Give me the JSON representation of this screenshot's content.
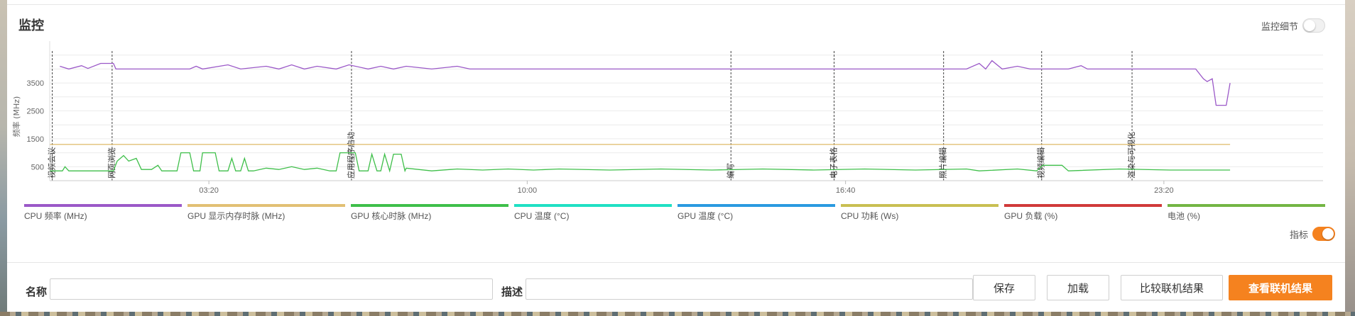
{
  "panel": {
    "title": "监控",
    "detail_toggle": {
      "label": "监控细节",
      "on": false
    },
    "indicator_toggle": {
      "label": "指标",
      "on": true
    }
  },
  "colors": {
    "accent": "#f5821f",
    "cpu_freq": "#9b59c8",
    "gpu_mem_clock": "#e2c074",
    "gpu_core_clock": "#3fbf4a",
    "cpu_temp": "#1fe0c4",
    "gpu_temp": "#2a9ae0",
    "cpu_power": "#c9bf52",
    "gpu_load": "#d03a3a",
    "battery": "#73b544"
  },
  "chart_data": {
    "type": "line",
    "ylabel": "频率 (MHz)",
    "ylim": [
      0,
      5000
    ],
    "y_ticks": [
      {
        "value": 500,
        "label": "500"
      },
      {
        "value": 1500,
        "label": "1500"
      },
      {
        "value": 2500,
        "label": "2500"
      },
      {
        "value": 3500,
        "label": "3500"
      }
    ],
    "x_range": [
      0,
      100
    ],
    "x_ticks": [
      {
        "x": 12.5,
        "label": "03:20"
      },
      {
        "x": 37.5,
        "label": "10:00"
      },
      {
        "x": 62.5,
        "label": "16:40"
      },
      {
        "x": 87.5,
        "label": "23:20"
      }
    ],
    "scenes": [
      {
        "x": 0.2,
        "label": "视频会议"
      },
      {
        "x": 4.9,
        "label": "网页浏览"
      },
      {
        "x": 23.7,
        "label": "应用程序启动"
      },
      {
        "x": 53.5,
        "label": "编写"
      },
      {
        "x": 61.6,
        "label": "电子表格"
      },
      {
        "x": 70.2,
        "label": "照片编辑"
      },
      {
        "x": 77.9,
        "label": "视频编辑"
      },
      {
        "x": 85.0,
        "label": "渲染与可视化"
      }
    ],
    "series": [
      {
        "name": "CPU 频率 (MHz)",
        "color": "#9b59c8",
        "points": [
          [
            0.8,
            4100
          ],
          [
            1.5,
            4000
          ],
          [
            2.5,
            4120
          ],
          [
            3,
            4020
          ],
          [
            4,
            4200
          ],
          [
            5,
            4200
          ],
          [
            5.2,
            4000
          ],
          [
            11,
            4000
          ],
          [
            11.5,
            4100
          ],
          [
            12,
            4000
          ],
          [
            14,
            4150
          ],
          [
            15,
            4000
          ],
          [
            17,
            4100
          ],
          [
            18,
            4000
          ],
          [
            19,
            4150
          ],
          [
            20,
            4000
          ],
          [
            21,
            4100
          ],
          [
            22.5,
            4000
          ],
          [
            23.5,
            4150
          ],
          [
            25,
            4000
          ],
          [
            26,
            4100
          ],
          [
            27,
            4000
          ],
          [
            28,
            4100
          ],
          [
            30,
            4000
          ],
          [
            32,
            4100
          ],
          [
            33,
            4000
          ],
          [
            48,
            4000
          ],
          [
            60,
            4000
          ],
          [
            72,
            4000
          ],
          [
            73,
            4200
          ],
          [
            73.5,
            4000
          ],
          [
            74,
            4300
          ],
          [
            74.8,
            4000
          ],
          [
            76,
            4100
          ],
          [
            77,
            4000
          ],
          [
            80,
            4000
          ],
          [
            81,
            4120
          ],
          [
            81.5,
            4000
          ],
          [
            86,
            4000
          ],
          [
            88,
            4000
          ],
          [
            90,
            4000
          ],
          [
            90.6,
            3650
          ],
          [
            90.9,
            3550
          ],
          [
            91.3,
            3650
          ],
          [
            91.6,
            2700
          ],
          [
            92.4,
            2700
          ],
          [
            92.7,
            3500
          ]
        ]
      },
      {
        "name": "GPU 显示内存时脉 (MHz)",
        "color": "#e2c074",
        "points": [
          [
            0,
            1300
          ],
          [
            92.7,
            1300
          ]
        ]
      },
      {
        "name": "GPU 核心时脉 (MHz)",
        "color": "#3fbf4a",
        "points": [
          [
            0,
            350
          ],
          [
            1,
            350
          ],
          [
            1.2,
            500
          ],
          [
            1.5,
            350
          ],
          [
            5,
            350
          ],
          [
            5.3,
            700
          ],
          [
            5.8,
            900
          ],
          [
            6.2,
            700
          ],
          [
            6.8,
            800
          ],
          [
            7.2,
            400
          ],
          [
            8,
            400
          ],
          [
            8.5,
            550
          ],
          [
            8.8,
            350
          ],
          [
            10,
            350
          ],
          [
            10.3,
            1000
          ],
          [
            11,
            1000
          ],
          [
            11.3,
            350
          ],
          [
            11.8,
            350
          ],
          [
            12,
            1000
          ],
          [
            13,
            1000
          ],
          [
            13.3,
            350
          ],
          [
            14,
            350
          ],
          [
            14.3,
            800
          ],
          [
            14.6,
            350
          ],
          [
            15,
            350
          ],
          [
            15.3,
            800
          ],
          [
            15.6,
            350
          ],
          [
            16,
            350
          ],
          [
            17,
            450
          ],
          [
            18,
            400
          ],
          [
            19,
            500
          ],
          [
            20,
            400
          ],
          [
            21,
            450
          ],
          [
            22,
            350
          ],
          [
            22.5,
            350
          ],
          [
            22.8,
            1000
          ],
          [
            24,
            1000
          ],
          [
            24.3,
            350
          ],
          [
            25,
            350
          ],
          [
            25.3,
            950
          ],
          [
            25.7,
            350
          ],
          [
            26,
            350
          ],
          [
            26.3,
            950
          ],
          [
            26.7,
            350
          ],
          [
            27,
            950
          ],
          [
            27.6,
            950
          ],
          [
            27.9,
            350
          ],
          [
            28,
            450
          ],
          [
            30,
            350
          ],
          [
            32,
            420
          ],
          [
            34,
            380
          ],
          [
            36,
            420
          ],
          [
            38,
            380
          ],
          [
            40,
            420
          ],
          [
            44,
            380
          ],
          [
            48,
            420
          ],
          [
            52,
            380
          ],
          [
            56,
            420
          ],
          [
            60,
            380
          ],
          [
            64,
            420
          ],
          [
            68,
            380
          ],
          [
            72,
            420
          ],
          [
            73,
            350
          ],
          [
            76,
            420
          ],
          [
            77.5,
            350
          ],
          [
            78,
            550
          ],
          [
            79.5,
            550
          ],
          [
            80,
            350
          ],
          [
            84,
            420
          ],
          [
            88,
            380
          ],
          [
            92.7,
            380
          ]
        ]
      }
    ],
    "legend": [
      {
        "label": "CPU 频率 (MHz)",
        "color": "#9b59c8"
      },
      {
        "label": "GPU 显示内存时脉 (MHz)",
        "color": "#e2c074"
      },
      {
        "label": "GPU 核心时脉 (MHz)",
        "color": "#3fbf4a"
      },
      {
        "label": "CPU 温度 (°C)",
        "color": "#1fe0c4"
      },
      {
        "label": "GPU 温度 (°C)",
        "color": "#2a9ae0"
      },
      {
        "label": "CPU 功耗 (Ws)",
        "color": "#c9bf52"
      },
      {
        "label": "GPU 负载 (%)",
        "color": "#d03a3a"
      },
      {
        "label": "电池 (%)",
        "color": "#73b544"
      }
    ],
    "grid": true,
    "legend_position": "bottom"
  },
  "form": {
    "name_label": "名称",
    "name_value": "",
    "desc_label": "描述",
    "desc_value": ""
  },
  "buttons": {
    "save": "保存",
    "load": "加载",
    "compare": "比较联机结果",
    "view": "查看联机结果"
  }
}
